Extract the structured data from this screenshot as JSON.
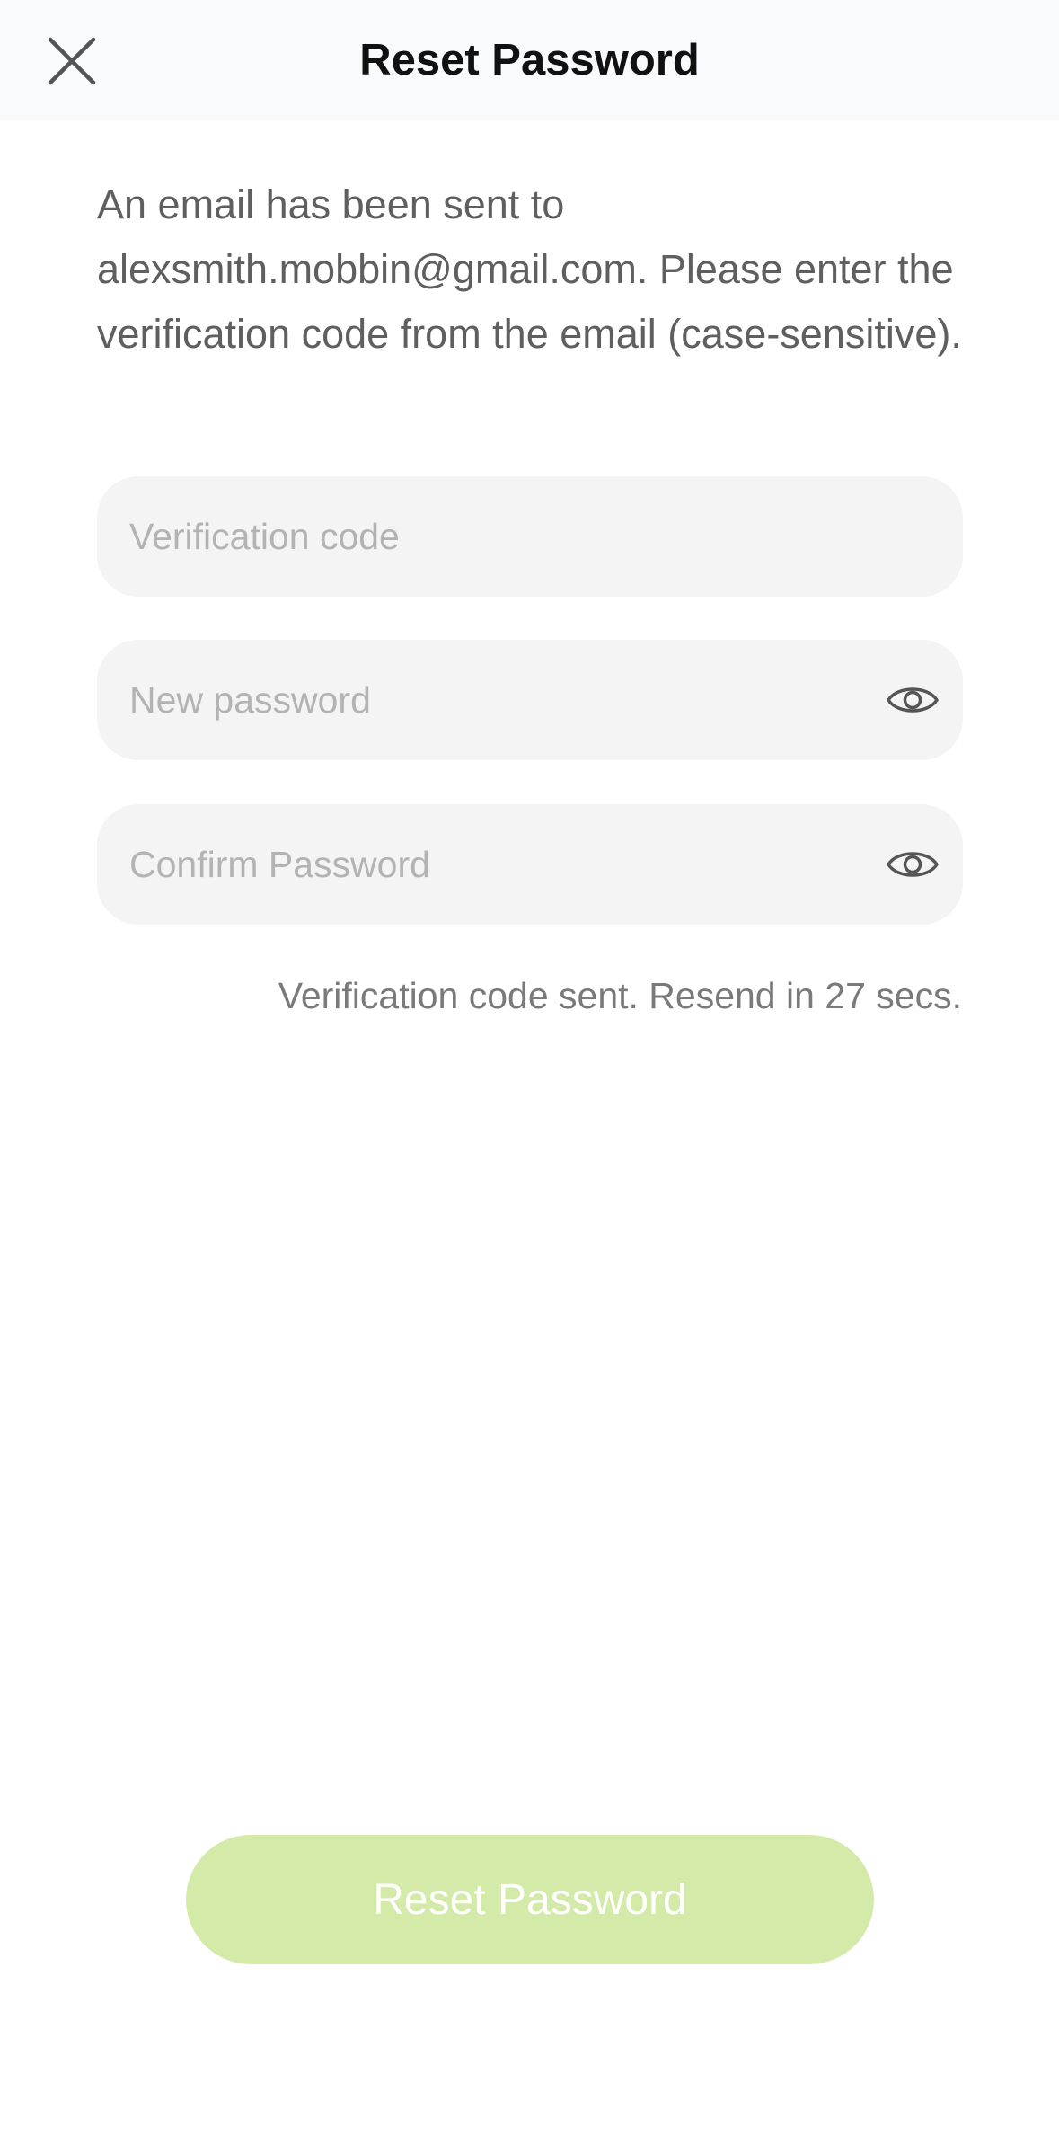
{
  "header": {
    "title": "Reset Password",
    "close_icon": "close-icon"
  },
  "message": "An email has been sent to alexsmith.mobbin@gmail.com. Please enter the verification code from the email (case-sensitive).",
  "fields": {
    "verification_code": {
      "placeholder": "Verification code",
      "value": ""
    },
    "new_password": {
      "placeholder": "New password",
      "value": "",
      "toggle_icon": "eye-icon"
    },
    "confirm_password": {
      "placeholder": "Confirm Password",
      "value": "",
      "toggle_icon": "eye-icon"
    }
  },
  "resend_note": "Verification code sent. Resend in 27 secs.",
  "submit": {
    "label": "Reset Password",
    "state": "disabled"
  },
  "colors": {
    "header_bg": "#f9fafb",
    "field_bg": "#f4f4f4",
    "button_bg_disabled": "#d3eaa8",
    "button_text": "#ffffff",
    "body_text": "#5f5f5f",
    "placeholder_text": "#b3b3b3"
  }
}
